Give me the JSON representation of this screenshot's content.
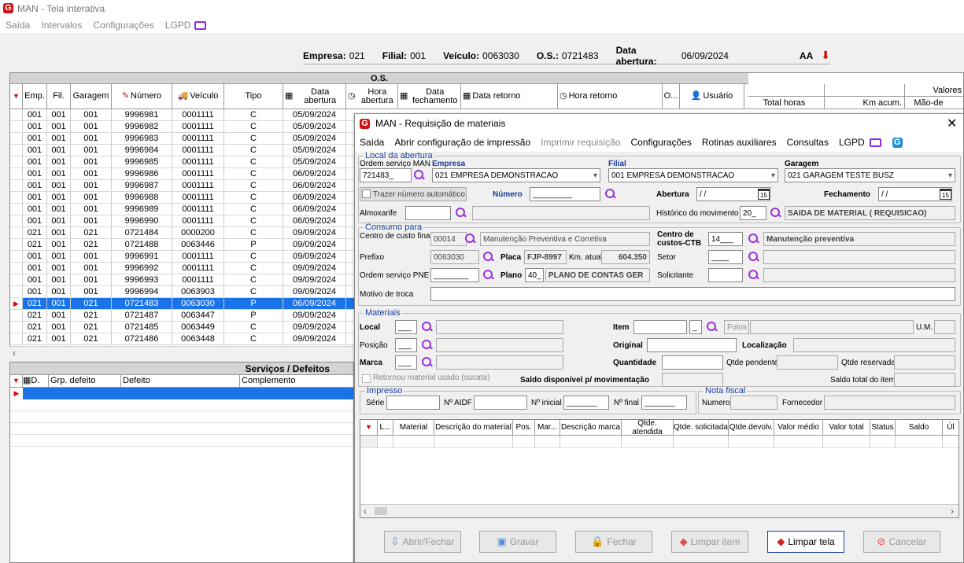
{
  "app": {
    "title": "MAN - Tela interativa",
    "menu": [
      "Saída",
      "Intervalos",
      "Configurações",
      "LGPD"
    ]
  },
  "summary": {
    "empresa_label": "Empresa:",
    "empresa": "021",
    "filial_label": "Filial:",
    "filial": "001",
    "veiculo_label": "Veículo:",
    "veiculo": "0063030",
    "os_label": "O.S.:",
    "os": "0721483",
    "data_label": "Data abertura:",
    "data": "06/09/2024",
    "font_icon": "AA"
  },
  "os_grid": {
    "group_title": "O.S.",
    "valores_title": "Valores",
    "columns": [
      "Emp.",
      "Fil.",
      "Garagem",
      "Número",
      "Veículo",
      "Tipo",
      "Data abertura",
      "Hora abertura",
      "Data fechamento",
      "Data retorno",
      "Hora retorno",
      "O...",
      "Usuário"
    ],
    "valores_columns": [
      "Total horas",
      "Km acum.",
      "Mão-de"
    ],
    "rows": [
      [
        "001",
        "001",
        "001",
        "9996981",
        "0001111",
        "C",
        "05/09/2024"
      ],
      [
        "001",
        "001",
        "001",
        "9996982",
        "0001111",
        "C",
        "05/09/2024"
      ],
      [
        "001",
        "001",
        "001",
        "9996983",
        "0001111",
        "C",
        "05/09/2024"
      ],
      [
        "001",
        "001",
        "001",
        "9996984",
        "0001111",
        "C",
        "05/09/2024"
      ],
      [
        "001",
        "001",
        "001",
        "9996985",
        "0001111",
        "C",
        "05/09/2024"
      ],
      [
        "001",
        "001",
        "001",
        "9996986",
        "0001111",
        "C",
        "06/09/2024"
      ],
      [
        "001",
        "001",
        "001",
        "9996987",
        "0001111",
        "C",
        "06/09/2024"
      ],
      [
        "001",
        "001",
        "001",
        "9996988",
        "0001111",
        "C",
        "06/09/2024"
      ],
      [
        "001",
        "001",
        "001",
        "9996989",
        "0001111",
        "C",
        "06/09/2024"
      ],
      [
        "001",
        "001",
        "001",
        "9996990",
        "0001111",
        "C",
        "06/09/2024"
      ],
      [
        "021",
        "001",
        "021",
        "0721484",
        "0000200",
        "C",
        "09/09/2024"
      ],
      [
        "021",
        "001",
        "021",
        "0721488",
        "0063446",
        "P",
        "09/09/2024"
      ],
      [
        "001",
        "001",
        "001",
        "9996991",
        "0001111",
        "C",
        "09/09/2024"
      ],
      [
        "001",
        "001",
        "001",
        "9996992",
        "0001111",
        "C",
        "09/09/2024"
      ],
      [
        "001",
        "001",
        "001",
        "9996993",
        "0001111",
        "C",
        "09/09/2024"
      ],
      [
        "001",
        "001",
        "001",
        "9996994",
        "0063903",
        "C",
        "09/09/2024"
      ],
      [
        "021",
        "001",
        "021",
        "0721483",
        "0063030",
        "P",
        "06/09/2024"
      ],
      [
        "021",
        "001",
        "021",
        "0721487",
        "0063447",
        "P",
        "09/09/2024"
      ],
      [
        "021",
        "001",
        "021",
        "0721485",
        "0063449",
        "C",
        "09/09/2024"
      ],
      [
        "021",
        "001",
        "021",
        "0721486",
        "0063448",
        "C",
        "09/09/2024"
      ]
    ],
    "selected_index": 16
  },
  "services": {
    "title": "Serviços / Defeitos",
    "columns": [
      "D.",
      "Grp. defeito",
      "Defeito",
      "Complemento"
    ]
  },
  "dialog": {
    "title": "MAN - Requisição de materiais",
    "close": "✕",
    "menu": [
      "Saída",
      "Abrir configuração de impressão",
      "Imprimir requisição",
      "Configurações",
      "Rotinas auxiliares",
      "Consultas",
      "LGPD"
    ],
    "local": {
      "legend": "Local da abertura",
      "os_label": "Ordem serviço MAN",
      "os_value": "721483_",
      "empresa_label": "Empresa",
      "empresa_value": "021 EMPRESA DEMONSTRACAO",
      "filial_label": "Filial",
      "filial_value": "001 EMPRESA DEMONSTRACAO",
      "garagem_label": "Garagem",
      "garagem_value": "021 GARAGEM TESTE BUSZ",
      "trazer_label": "Trazer número automático",
      "numero_label": "Número",
      "numero_value": "_________",
      "abertura_label": "Abertura",
      "abertura_value": "/ /",
      "fechamento_label": "Fechamento",
      "fechamento_value": "/ /",
      "almox_label": "Almoxarife",
      "historico_label": "Histórico do movimento",
      "historico_code": "20_",
      "historico_value": "SAIDA DE MATERIAL ( REQUISICAO)",
      "cal_day": "15"
    },
    "consumo": {
      "legend": "Consumo para",
      "ccf_label": "Centro de custo financeiro",
      "ccf_code": "00014",
      "ccf_value": "Manutenção Preventiva e Corretiva",
      "ccctb_label1": "Centro de",
      "ccctb_label2": "custos-CTB",
      "ccctb_code": "14___",
      "ccctb_value": "Manutenção preventiva",
      "prefixo_label": "Prefixo",
      "prefixo_value": "0063030",
      "placa_label": "Placa",
      "placa_value": "FJP-8997",
      "km_label": "Km. atual",
      "km_value": "604.350",
      "setor_label": "Setor",
      "setor_value": "____",
      "ospne_label": "Ordem serviço PNE",
      "ospne_value": "________",
      "plano_label": "Plano",
      "plano_code": "40_",
      "plano_value": "PLANO DE CONTAS GER",
      "solicitante_label": "Solicitante",
      "motivo_label": "Motivo de troca"
    },
    "materiais": {
      "legend": "Materiais",
      "local_label": "Local",
      "local_value": "___",
      "item_label": "Item",
      "item_sep": "_",
      "fotos_label": "Fotos",
      "um_label": "U.M.",
      "posicao_label": "Posição",
      "posicao_value": "___",
      "original_label": "Original",
      "localizacao_label": "Localização",
      "marca_label": "Marca",
      "marca_value": "___",
      "quantidade_label": "Quantidade",
      "qtde_pendente_label": "Qtde pendente",
      "qtde_reservada_label": "Qtde reservada",
      "retornou_label": "Retornou material usado (sucata)",
      "saldo_mov_label": "Saldo disponível p/ movimentação",
      "saldo_total_label": "Saldo total do item"
    },
    "impresso": {
      "legend": "Impresso",
      "serie_label": "Série",
      "aidf_label": "Nº AIDF",
      "inicial_label": "Nº inicial",
      "inicial_value": "_______",
      "final_label": "Nº final",
      "final_value": "_______"
    },
    "nota": {
      "legend": "Nota fiscal",
      "numero_label": "Numero",
      "fornecedor_label": "Fornecedor"
    },
    "table_columns": [
      "L...",
      "Material",
      "Descrição do material",
      "Pos.",
      "Mar...",
      "Descrição marca",
      "Qtde. atendida",
      "Qtde. solicitada",
      "Qtde.devolv.",
      "Valor médio",
      "Valor total",
      "Status",
      "Saldo",
      "Úl"
    ],
    "buttons": {
      "abrir": "Abrir/Fechar",
      "gravar": "Gravar",
      "fechar": "Fechar",
      "limpar_item": "Limpar item",
      "limpar_tela": "Limpar tela",
      "cancelar": "Cancelar"
    }
  },
  "colors": {
    "selection": "#1a73e8",
    "accent_purple": "#8a2be2",
    "logo_red": "#d01010",
    "legend_blue": "#1a3d9a"
  }
}
